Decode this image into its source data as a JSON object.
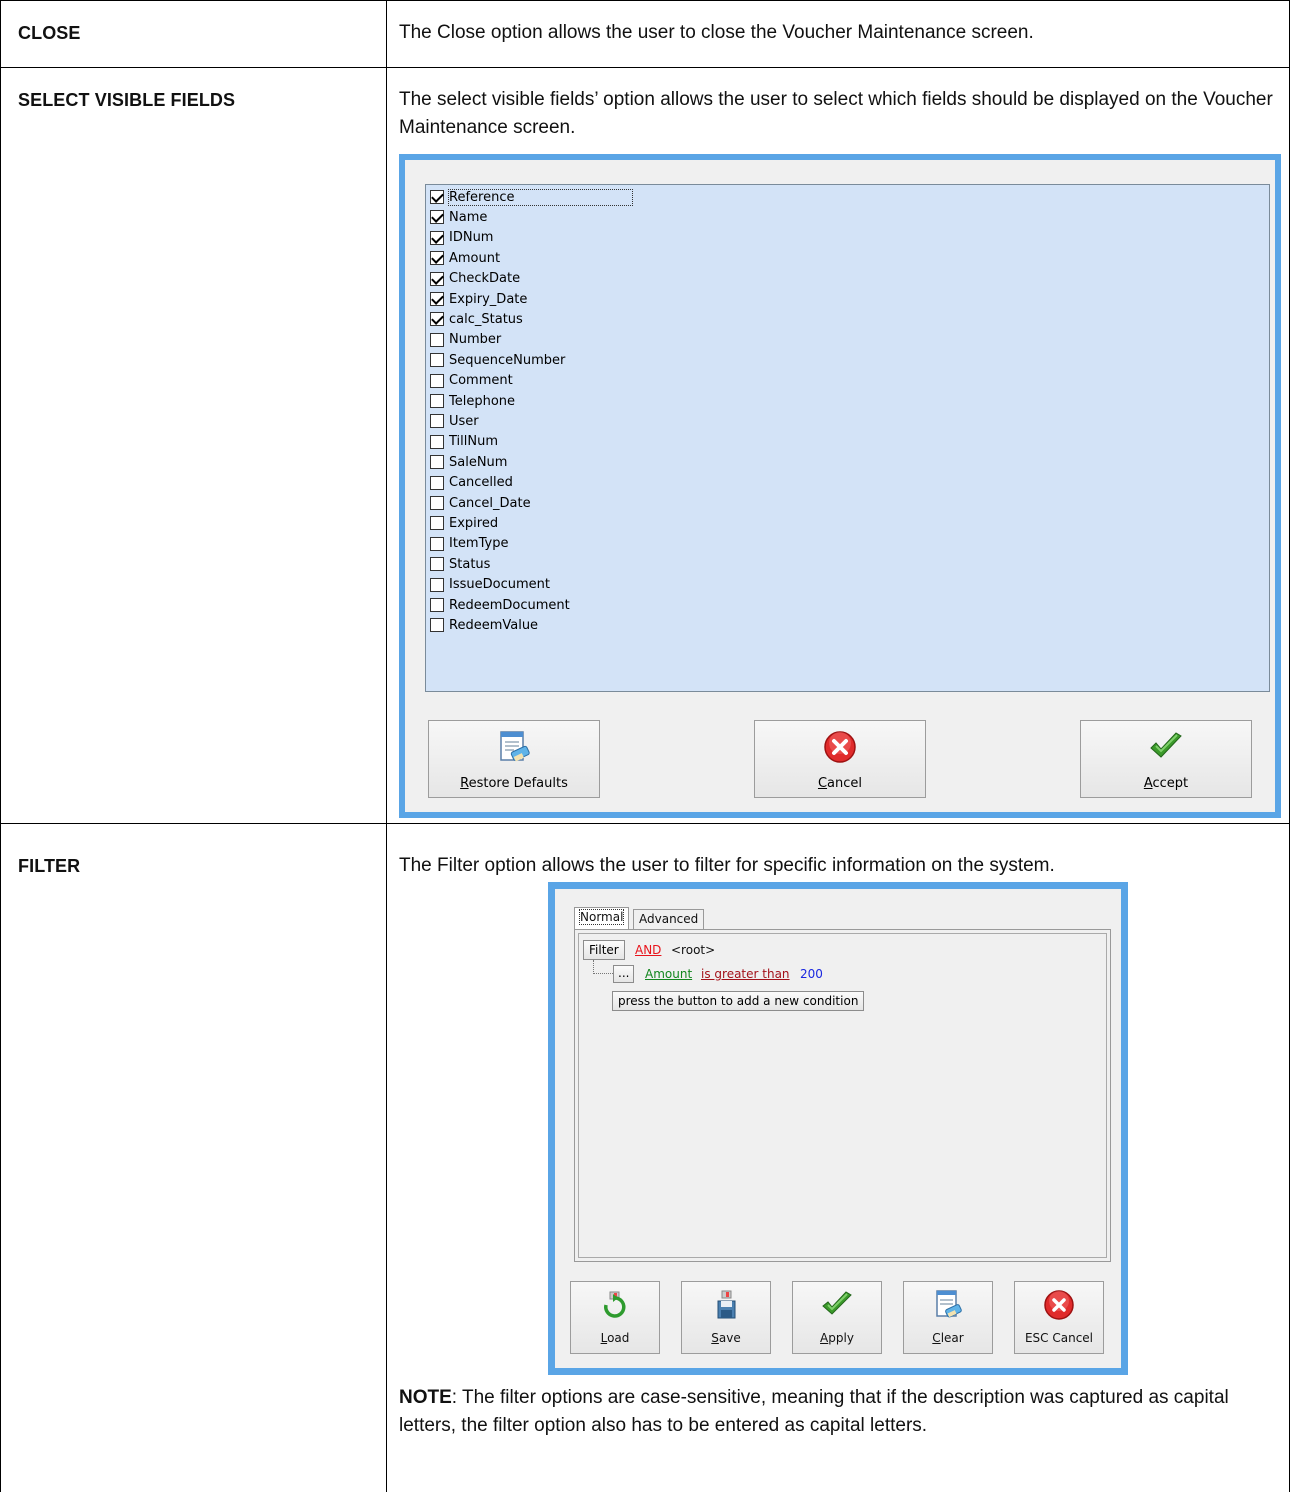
{
  "rows": [
    {
      "term": "CLOSE",
      "description": "The Close option allows the user to close the Voucher Maintenance screen."
    },
    {
      "term": "SELECT VISIBLE FIELDS",
      "description": "The select visible fields’ option allows the user to select which fields should be displayed on the Voucher Maintenance screen."
    },
    {
      "term": "FILTER",
      "description": "The Filter option allows the user to filter for specific information on the system.",
      "note_label": "NOTE",
      "note_text": ": The filter options are case-sensitive, meaning that if the description was captured as capital letters, the filter option also has to be entered as capital letters."
    }
  ],
  "visible_fields_dialog": {
    "fields": [
      {
        "label": "Reference",
        "checked": true
      },
      {
        "label": "Name",
        "checked": true
      },
      {
        "label": "IDNum",
        "checked": true
      },
      {
        "label": "Amount",
        "checked": true
      },
      {
        "label": "CheckDate",
        "checked": true
      },
      {
        "label": "Expiry_Date",
        "checked": true
      },
      {
        "label": "calc_Status",
        "checked": true
      },
      {
        "label": "Number",
        "checked": false
      },
      {
        "label": "SequenceNumber",
        "checked": false
      },
      {
        "label": "Comment",
        "checked": false
      },
      {
        "label": "Telephone",
        "checked": false
      },
      {
        "label": "User",
        "checked": false
      },
      {
        "label": "TillNum",
        "checked": false
      },
      {
        "label": "SaleNum",
        "checked": false
      },
      {
        "label": "Cancelled",
        "checked": false
      },
      {
        "label": "Cancel_Date",
        "checked": false
      },
      {
        "label": "Expired",
        "checked": false
      },
      {
        "label": "ItemType",
        "checked": false
      },
      {
        "label": "Status",
        "checked": false
      },
      {
        "label": "IssueDocument",
        "checked": false
      },
      {
        "label": "RedeemDocument",
        "checked": false
      },
      {
        "label": "RedeemValue",
        "checked": false
      }
    ],
    "buttons": {
      "restore": {
        "mnemonic": "R",
        "rest": "estore Defaults",
        "icon": "restore-defaults-icon"
      },
      "cancel": {
        "mnemonic": "C",
        "rest": "ancel",
        "icon": "cancel-icon"
      },
      "accept": {
        "mnemonic": "A",
        "rest": "ccept",
        "icon": "accept-check-icon"
      }
    }
  },
  "filter_dialog": {
    "tabs": [
      "Normal",
      "Advanced"
    ],
    "active_tab": "Normal",
    "filter_button": "Filter",
    "operator": "AND",
    "root": "<root>",
    "ellipsis_button": "...",
    "condition": {
      "field": "Amount",
      "comparison": "is greater than",
      "value": "200"
    },
    "add_condition_button": "press the button to add a new condition",
    "buttons": {
      "load": {
        "mnemonic": "L",
        "rest": "oad",
        "icon": "load-icon"
      },
      "save": {
        "mnemonic": "S",
        "rest": "ave",
        "icon": "save-icon"
      },
      "apply": {
        "mnemonic": "A",
        "rest": "pply",
        "icon": "apply-check-icon"
      },
      "clear": {
        "mnemonic": "C",
        "rest": "lear",
        "icon": "clear-icon"
      },
      "esc_cancel": {
        "label": "ESC Cancel",
        "icon": "cancel-icon"
      }
    }
  },
  "colors": {
    "dialog_frame": "#5aa5e6",
    "list_background": "#d3e3f7",
    "operator_red": "#e8141b",
    "field_green": "#12861e",
    "comparison_dark_red": "#a3121a",
    "value_blue": "#1a27e0"
  }
}
